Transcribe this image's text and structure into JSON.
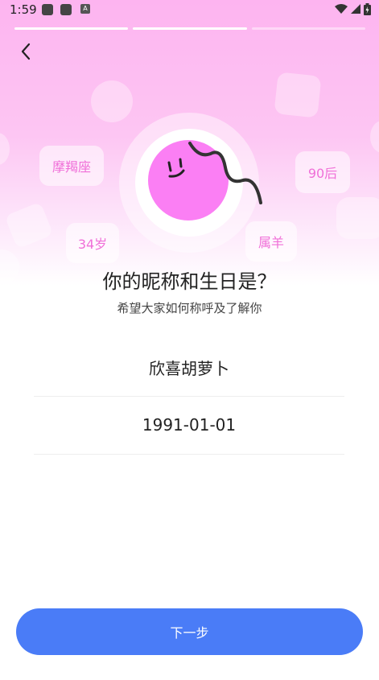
{
  "status_bar": {
    "time": "1:59",
    "notification_icon": "A"
  },
  "progress": {
    "total_steps": 3,
    "current_step": 2
  },
  "header": {
    "back_icon": "chevron-left-icon"
  },
  "tags": {
    "zodiac": "摩羯座",
    "generation": "90后",
    "age": "34岁",
    "chinese_zodiac": "属羊"
  },
  "main": {
    "title": "你的昵称和生日是？",
    "subtitle": "希望大家如何称呼及了解你",
    "nickname": "欣喜胡萝卜",
    "birthday": "1991-01-01"
  },
  "footer": {
    "next_label": "下一步"
  },
  "colors": {
    "accent": "#4a7cf7",
    "avatar": "#fb7ff4",
    "tag_text": "#f06fd8",
    "gradient_top": "#fdb4f0"
  }
}
